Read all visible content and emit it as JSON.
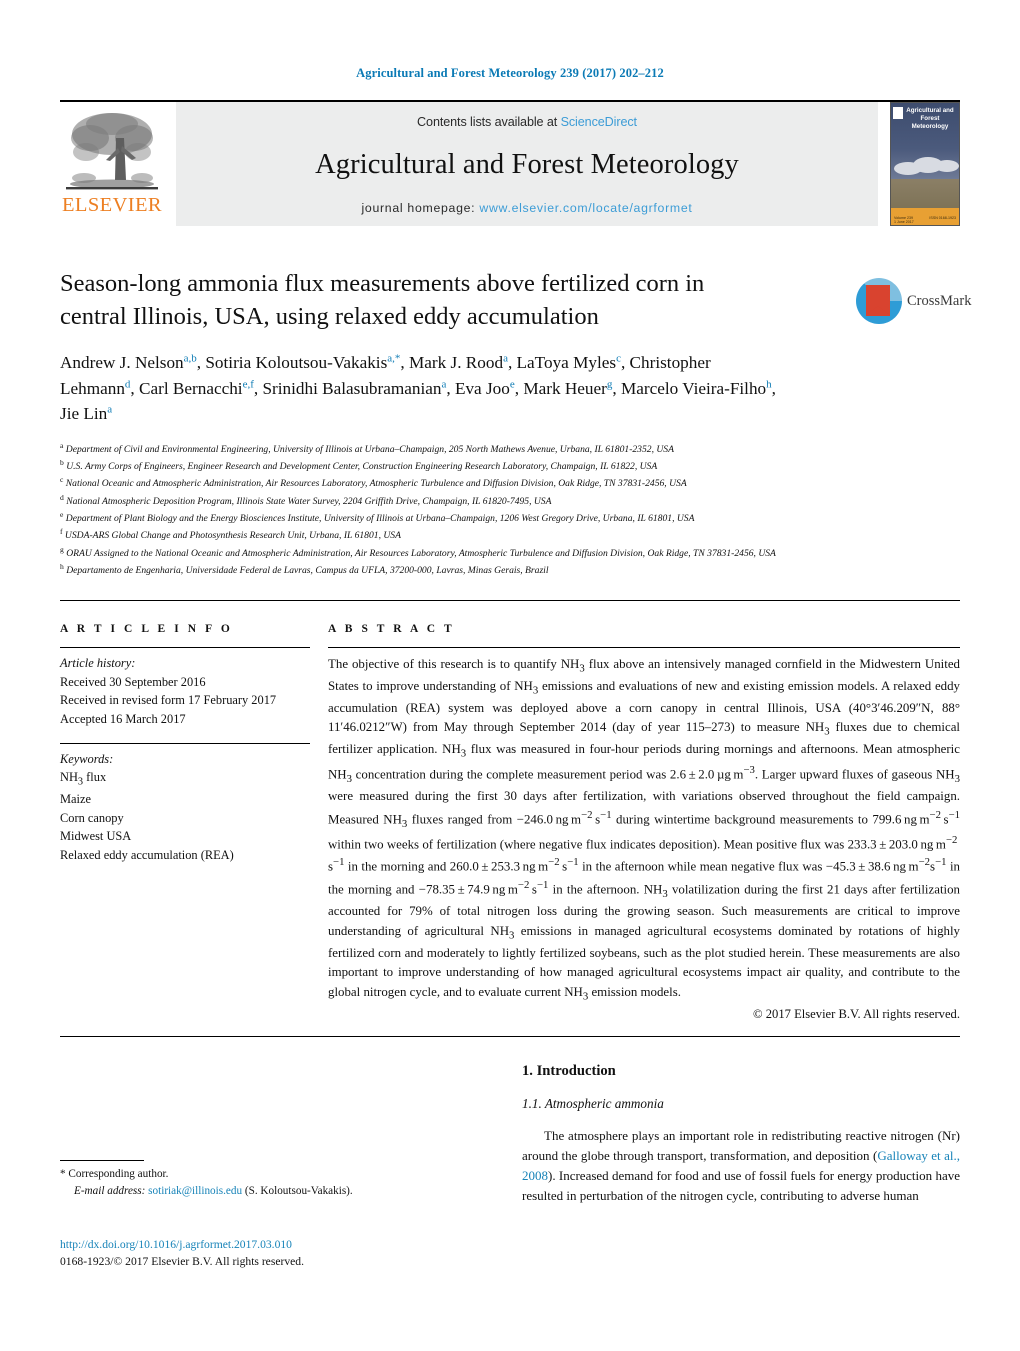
{
  "running_head": "Agricultural and Forest Meteorology 239 (2017) 202–212",
  "colors": {
    "link": "#1783b8",
    "header_link": "#3c9cd6",
    "elsevier_orange": "#ED7F22",
    "superscript": "#0f7cb5",
    "band_bg": "#eceded"
  },
  "journal_header": {
    "publisher": "ELSEVIER",
    "contents_prefix": "Contents lists available at ",
    "contents_link": "ScienceDirect",
    "journal_title": "Agricultural and Forest Meteorology",
    "homepage_prefix": "journal homepage: ",
    "homepage_url": "www.elsevier.com/locate/agrformet",
    "cover_title": "Agricultural and Forest Meteorology",
    "cover_bottom_left": "Volume 239\n1 June 2017",
    "cover_bottom_right": "ISSN 0168-1923"
  },
  "article": {
    "title": "Season-long ammonia flux measurements above fertilized corn in central Illinois, USA, using relaxed eddy accumulation",
    "crossmark_label": "CrossMark",
    "authors_html": "Andrew J. Nelson<sup>a,b</sup>, Sotiria Koloutsou-Vakakis<sup>a,*</sup>, Mark J. Rood<sup>a</sup>, LaToya Myles<sup>c</sup>, Christopher Lehmann<sup>d</sup>, Carl Bernacchi<sup>e,f</sup>, Srinidhi Balasubramanian<sup>a</sup>, Eva Joo<sup>e</sup>, Mark Heuer<sup>g</sup>, Marcelo Vieira-Filho<sup>h</sup>, Jie Lin<sup>a</sup>",
    "affiliations": [
      {
        "marker": "a",
        "text": "Department of Civil and Environmental Engineering, University of Illinois at Urbana–Champaign, 205 North Mathews Avenue, Urbana, IL 61801-2352, USA"
      },
      {
        "marker": "b",
        "text": "U.S. Army Corps of Engineers, Engineer Research and Development Center, Construction Engineering Research Laboratory, Champaign, IL 61822, USA"
      },
      {
        "marker": "c",
        "text": "National Oceanic and Atmospheric Administration, Air Resources Laboratory, Atmospheric Turbulence and Diffusion Division, Oak Ridge, TN 37831-2456, USA"
      },
      {
        "marker": "d",
        "text": "National Atmospheric Deposition Program, Illinois State Water Survey, 2204 Griffith Drive, Champaign, IL 61820-7495, USA"
      },
      {
        "marker": "e",
        "text": "Department of Plant Biology and the Energy Biosciences Institute, University of Illinois at Urbana–Champaign, 1206 West Gregory Drive, Urbana, IL 61801, USA"
      },
      {
        "marker": "f",
        "text": "USDA-ARS Global Change and Photosynthesis Research Unit, Urbana, IL 61801, USA"
      },
      {
        "marker": "g",
        "text": "ORAU Assigned to the National Oceanic and Atmospheric Administration, Air Resources Laboratory, Atmospheric Turbulence and Diffusion Division, Oak Ridge, TN 37831-2456, USA"
      },
      {
        "marker": "h",
        "text": "Departamento de Engenharia, Universidade Federal de Lavras, Campus da UFLA, 37200-000, Lavras, Minas Gerais, Brazil"
      }
    ]
  },
  "article_info": {
    "heading": "A R T I C L E   I N F O",
    "history_label": "Article history:",
    "history": [
      "Received 30 September 2016",
      "Received in revised form 17 February 2017",
      "Accepted 16 March 2017"
    ],
    "keywords_label": "Keywords:",
    "keywords_html": [
      "NH<sub>3</sub> flux",
      "Maize",
      "Corn canopy",
      "Midwest USA",
      "Relaxed eddy accumulation (REA)"
    ]
  },
  "abstract": {
    "heading": "A B S T R A C T",
    "body_html": "The objective of this research is to quantify NH<sub>3</sub> flux above an intensively managed cornfield in the Midwestern United States to improve understanding of NH<sub>3</sub> emissions and evaluations of new and existing emission models. A relaxed eddy accumulation (REA) system was deployed above a corn canopy in central Illinois, USA (40°3&#8242;46.209&#8243;N, 88° 11&#8242;46.0212&#8243;W) from May through September 2014 (day of year 115–273) to measure NH<sub>3</sub> fluxes due to chemical fertilizer application. NH<sub>3</sub> flux was measured in four-hour periods during mornings and afternoons. Mean atmospheric NH<sub>3</sub> concentration during the complete measurement period was 2.6&#8201;±&#8201;2.0&#8201;&#181;g&#8201;m<sup>−3</sup>. Larger upward fluxes of gaseous NH<sub>3</sub> were measured during the first 30 days after fertilization, with variations observed throughout the field campaign. Measured NH<sub>3</sub> fluxes ranged from −246.0&#8201;ng&#8201;m<sup>−2</sup>&#8201;s<sup>−1</sup> during wintertime background measurements to 799.6&#8201;ng&#8201;m<sup>−2</sup>&#8201;s<sup>−1</sup> within two weeks of fertilization (where negative flux indicates deposition). Mean positive flux was 233.3&#8201;±&#8201;203.0&#8201;ng&#8201;m<sup>−2</sup>&#8201;s<sup>−1</sup> in the morning and 260.0&#8201;±&#8201;253.3&#8201;ng&#8201;m<sup>−2</sup>&#8201;s<sup>−1</sup> in the afternoon while mean negative flux was −45.3&#8201;±&#8201;38.6&#8201;ng&#8201;m<sup>−2</sup>s<sup>−1</sup> in the morning and −78.35&#8201;±&#8201;74.9&#8201;ng&#8201;m<sup>−2</sup>&#8201;s<sup>−1</sup> in the afternoon. NH<sub>3</sub> volatilization during the first 21 days after fertilization accounted for 79% of total nitrogen loss during the growing season. Such measurements are critical to improve understanding of agricultural NH<sub>3</sub> emissions in managed agricultural ecosystems dominated by rotations of highly fertilized corn and moderately to lightly fertilized soybeans, such as the plot studied herein. These measurements are also important to improve understanding of how managed agricultural ecosystems impact air quality, and contribute to the global nitrogen cycle, and to evaluate current NH<sub>3</sub> emission models.",
    "copyright": "© 2017 Elsevier B.V. All rights reserved."
  },
  "body": {
    "section_heading": "1.  Introduction",
    "subsection_heading": "1.1.  Atmospheric ammonia",
    "paragraph_html": "The atmosphere plays an important role in redistributing reactive nitrogen (Nr) around the globe through transport, transformation, and deposition (<span class=\"lnk\">Galloway et al., 2008</span>). Increased demand for food and use of fossil fuels for energy production have resulted in perturbation of the nitrogen cycle, contributing to adverse human"
  },
  "footer": {
    "corresponding_marker": "*",
    "corresponding_label": "Corresponding author.",
    "email_label": "E-mail address:",
    "email": "sotiriak@illinois.edu",
    "email_owner": "(S. Koloutsou-Vakakis).",
    "doi": "http://dx.doi.org/10.1016/j.agrformet.2017.03.010",
    "issn_line": "0168-1923/© 2017 Elsevier B.V. All rights reserved."
  }
}
